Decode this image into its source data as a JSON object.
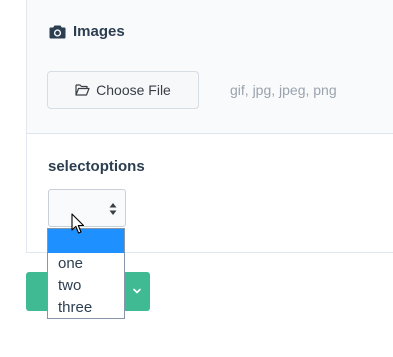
{
  "images": {
    "title": "Images",
    "icon": "camera-icon",
    "choose_button_label": "Choose File",
    "choose_button_icon": "folder-open-icon",
    "accepted_formats": "gif, jpg, jpeg, png"
  },
  "select": {
    "label": "selectoptions",
    "selected_value": "",
    "options": [
      "",
      "one",
      "two",
      "three"
    ],
    "highlighted_index": 0
  },
  "actions": {
    "button_color": "#3fba92",
    "toggle_icon": "chevron-down-icon"
  },
  "colors": {
    "highlight": "#1e90ff",
    "heading": "#2c3e50"
  }
}
